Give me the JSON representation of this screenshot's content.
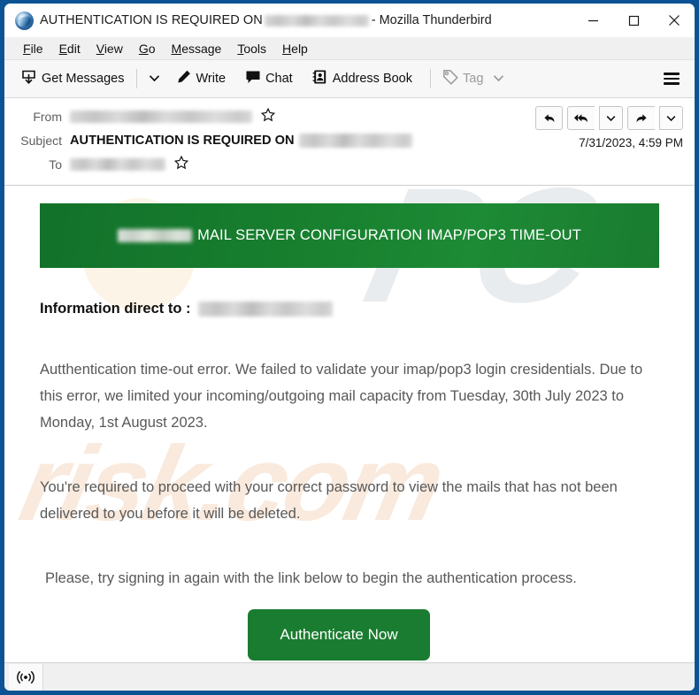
{
  "window": {
    "title_prefix": "AUTHENTICATION IS REQUIRED ON",
    "title_redacted": "[redacted email address]",
    "title_suffix": "- Mozilla Thunderbird",
    "logo_icon": "thunderbird-logo-icon",
    "controls": {
      "minimize": "minimize-icon",
      "maximize": "maximize-icon",
      "close": "close-icon"
    }
  },
  "menu_bar": {
    "items": [
      {
        "label": "File",
        "accel": "F"
      },
      {
        "label": "Edit",
        "accel": "E"
      },
      {
        "label": "View",
        "accel": "V"
      },
      {
        "label": "Go",
        "accel": "G"
      },
      {
        "label": "Message",
        "accel": "M"
      },
      {
        "label": "Tools",
        "accel": "T"
      },
      {
        "label": "Help",
        "accel": "H"
      }
    ]
  },
  "toolbar": {
    "get_messages": "Get Messages",
    "get_messages_icon": "inbox-download-icon",
    "get_messages_caret": "chevron-down-icon",
    "write": "Write",
    "write_icon": "pencil-icon",
    "chat": "Chat",
    "chat_icon": "speech-bubble-icon",
    "address_book": "Address Book",
    "address_book_icon": "address-book-icon",
    "tag": "Tag",
    "tag_icon": "tag-icon",
    "tag_caret": "chevron-down-icon",
    "tag_disabled": true,
    "app_menu_icon": "hamburger-menu-icon"
  },
  "message_header": {
    "from_label": "From",
    "from_value": "[redacted sender name and address]",
    "subject_label": "Subject",
    "subject_value": "AUTHENTICATION IS REQUIRED ON",
    "subject_redacted": "[redacted email address]",
    "to_label": "To",
    "to_value": "[redacted recipient address]",
    "date": "7/31/2023, 4:59 PM",
    "star_icon": "star-outline-icon",
    "actions": [
      {
        "name": "reply-button",
        "icon": "reply-arrow-icon"
      },
      {
        "name": "reply-all-button",
        "icon": "reply-all-arrow-icon"
      },
      {
        "name": "reply-all-dropdown",
        "icon": "chevron-down-icon"
      },
      {
        "name": "forward-button",
        "icon": "forward-arrow-icon"
      },
      {
        "name": "forward-dropdown",
        "icon": "chevron-down-icon"
      }
    ]
  },
  "message_body": {
    "banner_redacted": "[redacted brand logo]",
    "banner_title": "MAIL SERVER CONFIGURATION IMAP/POP3 TIME-OUT",
    "banner_color": "#1a7c30",
    "info_label": "Information direct to  :",
    "info_redacted": "[redacted email address]",
    "paragraph_1": "Autthentication time-out error. We failed to validate your imap/pop3 login cresidentials. Due to this error, we limited your incoming/outgoing mail capacity from Tuesday, 30th July 2023 to Monday, 1st August 2023.",
    "paragraph_2": "You're required to proceed with your correct password to view the mails that has not been delivered to you before it will be deleted.",
    "paragraph_3": "Please, try signing in again with the link below to begin the authentication process.",
    "cta_label": "Authenticate Now",
    "cta_color": "#1a7c30",
    "watermark_top": "PC",
    "watermark_bottom": "risk.com"
  },
  "status_bar": {
    "icon": "broadcast-signal-icon",
    "text": ""
  }
}
